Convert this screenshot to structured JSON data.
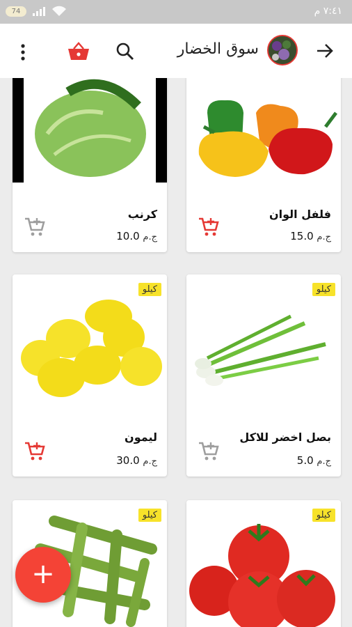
{
  "status_bar": {
    "time": "٧:٤١ م",
    "battery": "74"
  },
  "app_bar": {
    "title": "سوق الخضار"
  },
  "products": [
    {
      "name": "فلفل الوان",
      "price": "15.0",
      "currency": "ج.م",
      "badge": "",
      "cart_color": "#e53935"
    },
    {
      "name": "كرنب",
      "price": "10.0",
      "currency": "ج.م",
      "badge": "",
      "cart_color": "#9e9e9e"
    },
    {
      "name": "بصل اخضر للاكل",
      "price": "5.0",
      "currency": "ج.م",
      "badge": "كيلو",
      "cart_color": "#9e9e9e"
    },
    {
      "name": "ليمون",
      "price": "30.0",
      "currency": "ج.م",
      "badge": "كيلو",
      "cart_color": "#e53935"
    },
    {
      "name": "",
      "price": "",
      "currency": "",
      "badge": "كيلو",
      "cart_color": "#e53935"
    },
    {
      "name": "",
      "price": "",
      "currency": "",
      "badge": "كيلو",
      "cart_color": "#e53935"
    }
  ],
  "fab": {
    "label": "+"
  },
  "colors": {
    "accent": "#f44336",
    "badge": "#f7e22a"
  }
}
